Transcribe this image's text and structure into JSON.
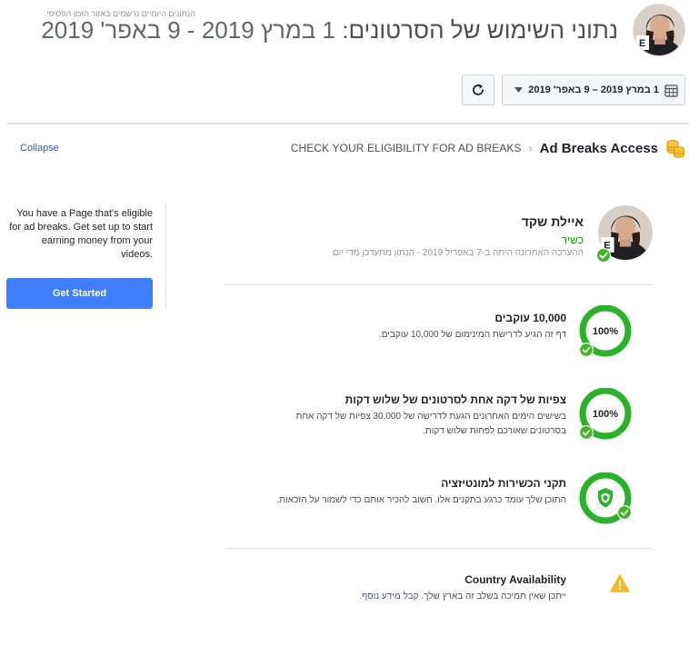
{
  "header": {
    "tiny_note": "הנתונים היומיים נרשמים באזור הזמן הפסיפי.",
    "title_label": "נתוני השימוש של הסרטונים:",
    "title_dates": "1 במרץ 2019 - 9 באפר' 2019"
  },
  "toolbar": {
    "date_range": "1 במרץ 2019 – 9 באפר' 2019",
    "refresh_icon": "refresh-icon",
    "calendar_icon": "calendar-icon",
    "caret_icon": "caret-down-icon"
  },
  "breadcrumb": {
    "step": "CHECK YOUR ELIGIBILITY FOR AD BREAKS",
    "separator": "›",
    "title": "Ad Breaks Access",
    "icon": "coins-icon"
  },
  "sidebar": {
    "collapse_label": "Collapse",
    "message": "You have a Page that's eligible for ad breaks. Get set up to start earning money from your videos.",
    "button_label": "Get Started"
  },
  "profile": {
    "name": "איילת שקד",
    "status": "כשיר",
    "note": "ההערכה האחרונה היתה ב-7 באפריל 2019 - הנתון מתעדכן מדי יום"
  },
  "requirements": [
    {
      "title": "10,000 עוקבים",
      "description": "דף זה הגיע לדרישת המינימום של 10,000 עוקבים.",
      "progress_label": "100%",
      "progress": 1.0,
      "status": "passed"
    },
    {
      "title": "צפיות של דקה אחת לסרטונים של שלוש דקות",
      "description": "בשישים הימים האחרונים הגעת לדרישה של 30,000 צפיות של דקה אחת בסרטונים שאורכם לפחות שלוש דקות.",
      "progress_label": "100%",
      "progress": 1.0,
      "status": "passed"
    },
    {
      "title": "תקני הכשירות למונטיזציה",
      "description": "התוכן שלך עומד כרגע בתקנים אלו. חשוב להכיר אותם כדי לשמור על הזכאות.",
      "icon": "shield-icon",
      "status": "passed"
    }
  ],
  "country": {
    "title": "Country Availability",
    "description": "ייתכן שאין תמיכה בשלב זה בארץ שלך.",
    "link": "קבל מידע נוסף.",
    "icon": "warning-icon"
  },
  "colors": {
    "accent_green": "#00a400",
    "ring_green": "#2ab32a",
    "button_blue": "#4080ff",
    "link_blue": "#365899",
    "warning_yellow": "#f7b928",
    "coins_gold": "#f5c33b"
  }
}
